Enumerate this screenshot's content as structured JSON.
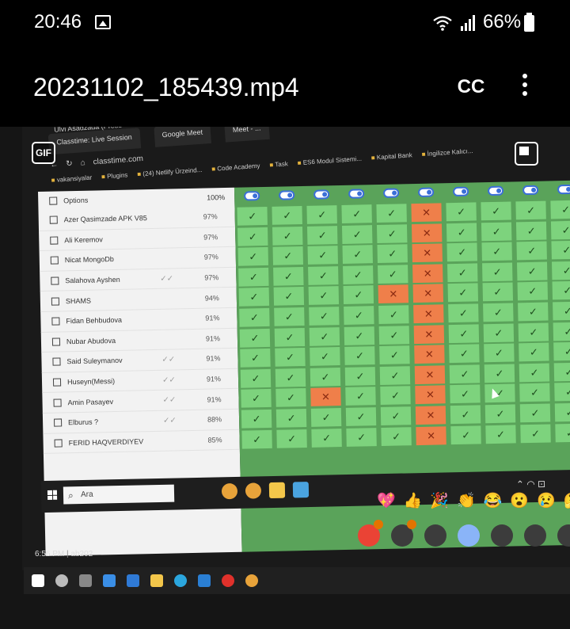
{
  "status_bar": {
    "time": "20:46",
    "battery": "66%",
    "icons": [
      "gallery-icon",
      "wifi-icon",
      "signal-icon",
      "battery-icon"
    ]
  },
  "player": {
    "title": "20231102_185439.mp4",
    "cc_label": "CC",
    "gif_label": "GIF"
  },
  "browser": {
    "presenter": "Ulvi Asadzada (Prese",
    "tabs": [
      "Classtime: Live Session",
      "Google Meet",
      "Meet - ..."
    ],
    "url": "classtime.com",
    "bookmarks": [
      "vakansiyalar",
      "Plugins",
      "(24) Netlify Ürzeind...",
      "Code Academy",
      "Task",
      "ES6 Modul Sistemi...",
      "Kapital Bank",
      "İngilizce Kalıcı..."
    ]
  },
  "sheet": {
    "options_label": "Options",
    "header_percent": "100%",
    "students": [
      {
        "name": "Azer Qasimzade APK V85",
        "pct": "97%",
        "seen": ""
      },
      {
        "name": "Ali Keremov",
        "pct": "97%",
        "seen": ""
      },
      {
        "name": "Nicat MongoDb",
        "pct": "97%",
        "seen": ""
      },
      {
        "name": "Salahova Ayshen",
        "pct": "97%",
        "seen": "✓✓"
      },
      {
        "name": "SHAMS",
        "pct": "94%",
        "seen": ""
      },
      {
        "name": "Fidan Behbudova",
        "pct": "91%",
        "seen": ""
      },
      {
        "name": "Nubar Abudova",
        "pct": "91%",
        "seen": ""
      },
      {
        "name": "Said Suleymanov",
        "pct": "91%",
        "seen": "✓✓"
      },
      {
        "name": "Huseyn(Messi)",
        "pct": "91%",
        "seen": "✓✓"
      },
      {
        "name": "Amin Pasayev",
        "pct": "91%",
        "seen": "✓✓"
      },
      {
        "name": "Elburus ?",
        "pct": "88%",
        "seen": "✓✓"
      },
      {
        "name": "FERID HAQVERDIYEV",
        "pct": "85%",
        "seen": ""
      }
    ],
    "columns": 10,
    "wrong_cells": [
      [
        0,
        5
      ],
      [
        1,
        5
      ],
      [
        2,
        5
      ],
      [
        3,
        5
      ],
      [
        4,
        4
      ],
      [
        4,
        5
      ],
      [
        5,
        5
      ],
      [
        6,
        5
      ],
      [
        7,
        5
      ],
      [
        8,
        5
      ],
      [
        9,
        2
      ],
      [
        9,
        5
      ],
      [
        10,
        5
      ],
      [
        11,
        5
      ]
    ],
    "correct_symbol": "✓",
    "wrong_symbol": "✕",
    "colors": {
      "correct": "#7dd37d",
      "wrong": "#ef7f4a",
      "toggle": "#3b6fd8"
    }
  },
  "windows": {
    "search_placeholder": "Ara",
    "taskbar_apps": [
      "chrome-icon",
      "chrome-icon",
      "file-explorer-icon",
      "store-icon"
    ]
  },
  "meet": {
    "reactions": [
      "💖",
      "👍",
      "🎉",
      "👏",
      "😂",
      "😮",
      "😢",
      "🤔"
    ],
    "meeting_time": "6:56 PM",
    "meeting_code": "ab202"
  }
}
